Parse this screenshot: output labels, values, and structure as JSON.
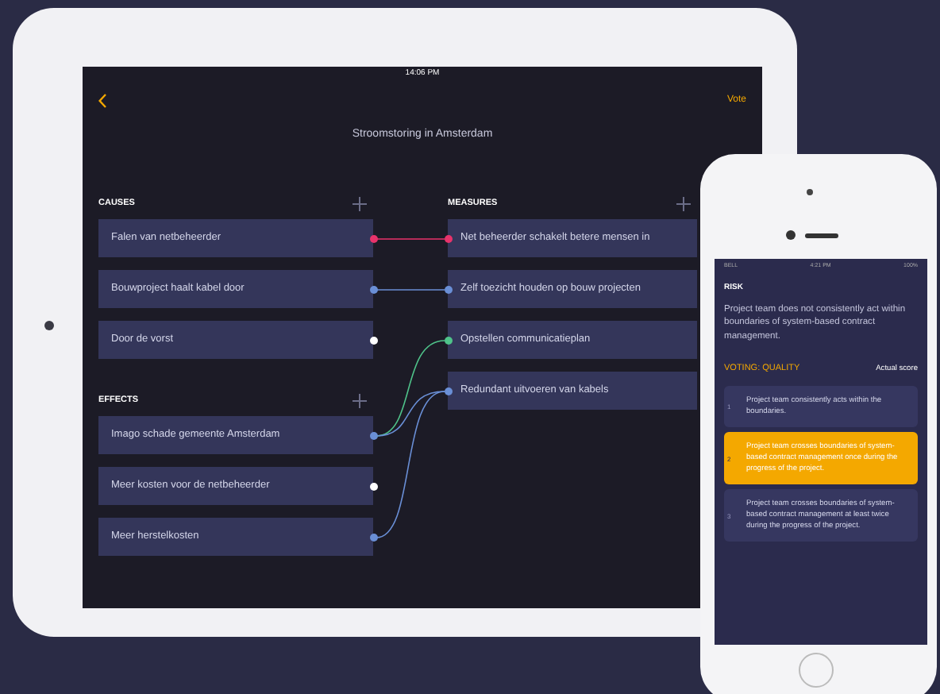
{
  "tablet": {
    "status_bar": {
      "time": "14:06 PM"
    },
    "nav": {
      "vote": "Vote"
    },
    "title": "Stroomstoring in Amsterdam",
    "causes": {
      "heading": "CAUSES",
      "items": [
        {
          "label": "Falen van netbeheerder",
          "color": "#e8336b",
          "linked": [
            true,
            false,
            false,
            false
          ]
        },
        {
          "label": "Bouwproject haalt kabel door",
          "color": "#6a8fd6",
          "linked": [
            false,
            true,
            false,
            false
          ]
        },
        {
          "label": "Door de vorst",
          "color": "#ffffff",
          "linked": [
            false,
            false,
            false,
            false
          ]
        }
      ]
    },
    "effects": {
      "heading": "EFFECTS",
      "items": [
        {
          "label": "Imago schade gemeente Amsterdam",
          "color": "#6a8fd6",
          "linked": [
            false,
            false,
            true,
            true
          ]
        },
        {
          "label": "Meer kosten voor de netbeheerder",
          "color": "#ffffff",
          "linked": [
            false,
            false,
            false,
            false
          ]
        },
        {
          "label": "Meer herstelkosten",
          "color": "#6a8fd6",
          "linked": [
            false,
            false,
            false,
            true
          ]
        }
      ]
    },
    "measures": {
      "heading": "MEASURES",
      "items": [
        {
          "label": "Net beheerder schakelt betere mensen in",
          "color": "#e8336b"
        },
        {
          "label": "Zelf toezicht houden op bouw projecten",
          "color": "#6a8fd6"
        },
        {
          "label": "Opstellen communicatieplan",
          "color": "#4fc38a"
        },
        {
          "label": "Redundant uitvoeren van kabels",
          "color": "#6a8fd6"
        }
      ]
    }
  },
  "phone": {
    "status_bar": {
      "carrier": "BELL",
      "time": "4:21 PM",
      "battery": "100%"
    },
    "heading": "RISK",
    "description": "Project team does not consistently act within boundaries of system-based contract management.",
    "voting_label": "VOTING: QUALITY",
    "score_label": "Actual score",
    "options": [
      {
        "number": "1",
        "text": "Project team consistently acts within the boundaries.",
        "selected": false
      },
      {
        "number": "2",
        "text": "Project team crosses boundaries of system-based contract management once during the progress of the project.",
        "selected": true
      },
      {
        "number": "3",
        "text": "Project team crosses boundaries of system-based contract management at least twice during the progress of the project.",
        "selected": false
      }
    ]
  }
}
